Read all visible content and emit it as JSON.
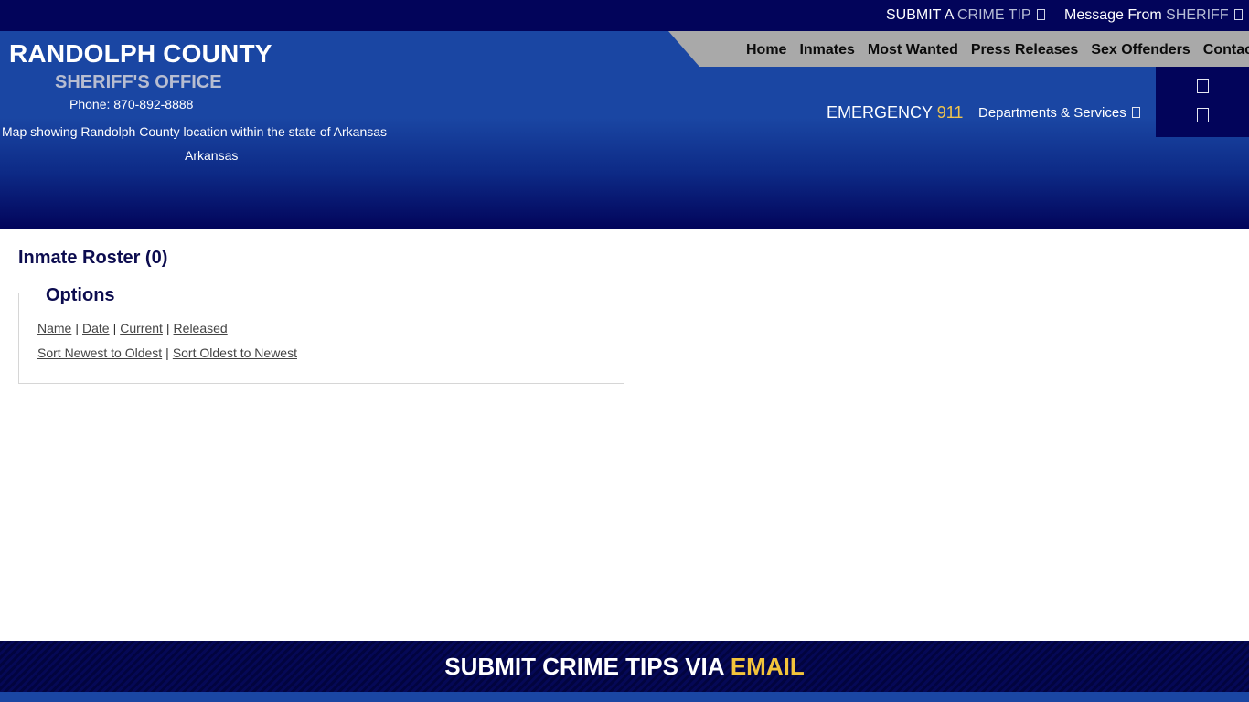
{
  "topbar": {
    "tip_prefix": "SUBMIT A",
    "tip_accent": "CRIME TIP",
    "sheriff_prefix": "Message From",
    "sheriff_accent": "SHERIFF"
  },
  "brand": {
    "title": "RANDOLPH COUNTY",
    "subtitle": "SHERIFF'S OFFICE",
    "phone_label": "Phone:",
    "phone": "870-892-8888",
    "map_alt": "Map showing Randolph County location within the state of Arkansas",
    "map_caption": "Arkansas"
  },
  "nav": {
    "items": [
      "Home",
      "Inmates",
      "Most Wanted",
      "Press Releases",
      "Sex Offenders",
      "Contact"
    ]
  },
  "emergency": {
    "label": "EMERGENCY",
    "number": "911"
  },
  "departments": {
    "label": "Departments & Services"
  },
  "main": {
    "title": "Inmate Roster (0)",
    "options": {
      "legend": "Options",
      "filter_links": [
        "Name",
        "Date",
        "Current",
        "Released"
      ],
      "sort_links": [
        "Sort Newest to Oldest",
        "Sort Oldest to Newest"
      ]
    }
  },
  "footer": {
    "text": "SUBMIT CRIME TIPS VIA",
    "accent": "EMAIL"
  },
  "colors": {
    "navy": "#02045a",
    "header_blue": "#1a46a3",
    "nav_grey": "#a9a9a9",
    "emergency_gold": "#f0c44c",
    "footer_gold": "#f3c43b",
    "title_navy": "#0c0c4f"
  }
}
